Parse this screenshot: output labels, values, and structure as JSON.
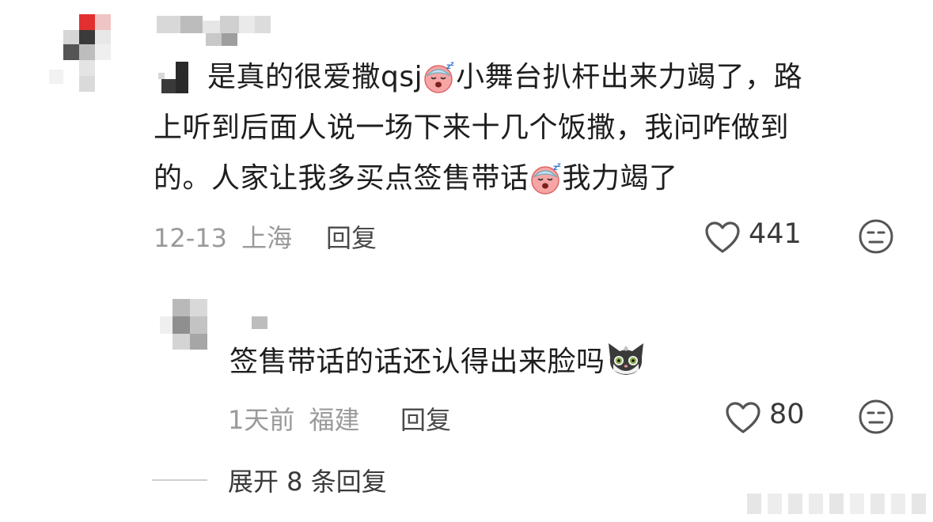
{
  "comment": {
    "text_line1_a": "是真的很爱撒qsj",
    "text_line1_b": "小舞台扒杆出来力竭了，路",
    "text_line2": "上听到后面人说一场下来十几个饭撒，我问咋做到",
    "text_line3_a": "的。人家让我多买点签售带话",
    "text_line3_b": "我力竭了",
    "date": "12-13",
    "location": "上海",
    "reply_label": "回复",
    "like_count": "441",
    "emoji_name": "sleepy-face-emoji"
  },
  "reply": {
    "text": "签售带话的话还认得出来脸吗",
    "date": "1天前",
    "location": "福建",
    "reply_label": "回复",
    "like_count": "80",
    "emoji_name": "cat-face-emoji"
  },
  "expand": {
    "label": "展开 8 条回复"
  },
  "icons": {
    "like": "heart-outline-icon",
    "react": "neutral-face-icon"
  },
  "colors": {
    "meta_gray": "#9a9a9a",
    "text": "#1e1e1e",
    "icon": "#555555"
  }
}
